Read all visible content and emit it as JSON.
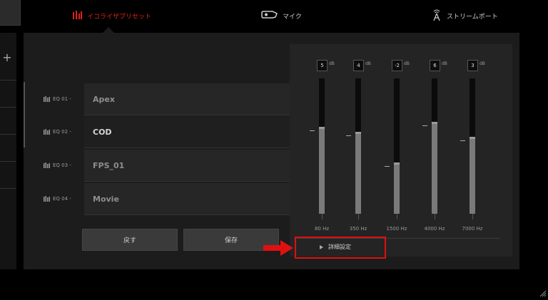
{
  "tabs": [
    {
      "label": "イコライザプリセット",
      "icon": "equalizer-icon",
      "active": true
    },
    {
      "label": "マイク",
      "icon": "microphone-icon",
      "active": false
    },
    {
      "label": "ストリームポート",
      "icon": "antenna-icon",
      "active": false
    }
  ],
  "sidebar": {
    "add_symbol": "+"
  },
  "presets": [
    {
      "code": "EQ 01 -",
      "name": "Apex",
      "selected": false
    },
    {
      "code": "EQ 02 -",
      "name": "COD",
      "selected": true
    },
    {
      "code": "EQ 03 -",
      "name": "FPS_01",
      "selected": false
    },
    {
      "code": "EQ 04 -",
      "name": "Movie",
      "selected": false
    }
  ],
  "buttons": {
    "reset_label": "戻す",
    "save_label": "保存"
  },
  "eq": {
    "unit": "dB",
    "range_db": [
      -12,
      12
    ],
    "bands": [
      {
        "freq": "80 Hz",
        "gain": "5"
      },
      {
        "freq": "350 Hz",
        "gain": "4"
      },
      {
        "freq": "1500 Hz",
        "gain": "-2"
      },
      {
        "freq": "4000 Hz",
        "gain": "6"
      },
      {
        "freq": "7000 Hz",
        "gain": "3"
      }
    ]
  },
  "advanced": {
    "label": "詳細設定"
  },
  "colors": {
    "accent": "#e2231a",
    "annotation": "#e01010"
  }
}
